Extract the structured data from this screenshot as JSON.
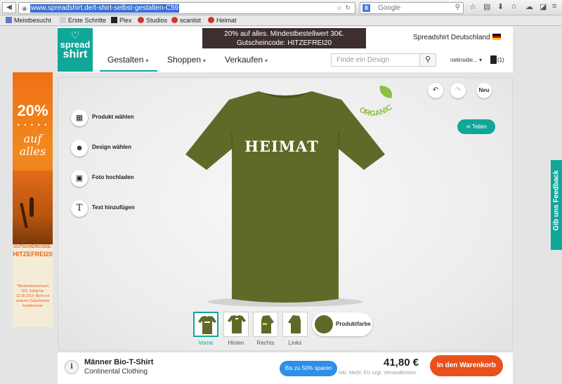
{
  "browser": {
    "url": "www.spreadshirt.de/t-shirt-selbst-gestalten-C59",
    "search_placeholder": "Google",
    "bookmarks": [
      {
        "label": "Meistbesucht",
        "color": "#5c7ac8"
      },
      {
        "label": "Erste Schritte",
        "color": "#d0d0d0"
      },
      {
        "label": "Plex",
        "color": "#222222"
      },
      {
        "label": "Studios",
        "color": "#d0362a"
      },
      {
        "label": "scanlist",
        "color": "#d0362a"
      },
      {
        "label": "Heimat",
        "color": "#d0362a"
      }
    ]
  },
  "site": {
    "logo": {
      "line1": "spread",
      "line2": "shirt"
    },
    "promo": {
      "line1": "20% auf alles. Mindestbestellwert 30€.",
      "line2": "Gutscheincode: HITZEFREI20"
    },
    "country": "Spreadshirt Deutschland",
    "nav": [
      "Gestalten",
      "Shoppen",
      "Verkaufen"
    ],
    "search_placeholder": "Finde ein Design",
    "user": "netinside...",
    "cart_count": "(1)",
    "accent": "#10a799"
  },
  "ad": {
    "percent": "20%",
    "dots": "• • • • •",
    "line1": "auf",
    "line2": "alles",
    "code_label": "GUTSCHEINCODE:",
    "code": "HITZEFREI20",
    "fine_print": "*Mindestbestell-wert 30€. Gültig bis 12.08.2014. Nicht mit anderen Gutscheinen kombinierbar"
  },
  "designer": {
    "tools": [
      "Produkt wählen",
      "Design wählen",
      "Foto hochladen",
      "Text hinzufügen"
    ],
    "new_label": "Neu",
    "share_label": "Teilen",
    "badge": "ORGANIC",
    "design_text": "HEIMAT",
    "shirt_color": "#5f6a28",
    "views": [
      "Vorne",
      "Hinten",
      "Rechts",
      "Links"
    ],
    "color_label": "Produktfarbe"
  },
  "product": {
    "name": "Männer Bio-T-Shirt",
    "brand": "Continental Clothing",
    "save_label": "Bis zu 50% sparen",
    "price": "41,80 €",
    "tax_note": "inkl. MwSt. EU     zzgl. Versandkosten",
    "cart_label": "In den Warenkorb"
  },
  "feedback_label": "Gib uns Feedback"
}
